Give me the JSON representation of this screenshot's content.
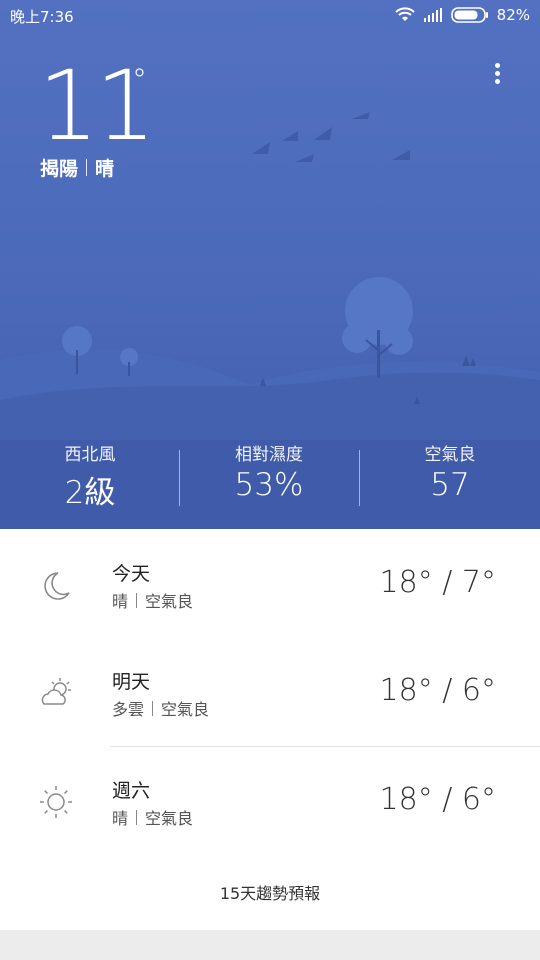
{
  "status_bar": {
    "time": "晚上7:36",
    "battery_percent": "82%",
    "battery_level": 0.82,
    "icons": [
      "wifi-icon",
      "signal-icon",
      "battery-icon"
    ]
  },
  "current": {
    "temperature": "11",
    "degree_symbol": "°",
    "city": "揭陽",
    "condition": "晴"
  },
  "stats": [
    {
      "label": "西北風",
      "value": "2級"
    },
    {
      "label": "相對濕度",
      "value": "53%"
    },
    {
      "label": "空氣良",
      "value": "57"
    }
  ],
  "forecast": [
    {
      "day": "今天",
      "condition": "晴",
      "air": "空氣良",
      "temps": "18° / 7°",
      "icon": "moon-icon"
    },
    {
      "day": "明天",
      "condition": "多雲",
      "air": "空氣良",
      "temps": "18° / 6°",
      "icon": "partly-cloudy-icon"
    },
    {
      "day": "週六",
      "condition": "晴",
      "air": "空氣良",
      "temps": "18° / 6°",
      "icon": "sun-icon"
    }
  ],
  "trend_button": "15天趨勢預報",
  "colors": {
    "hero_top": "#5371c0",
    "hero_bottom": "#3f5ba9",
    "hill": "#4663b3",
    "tree": "#5677c6"
  }
}
